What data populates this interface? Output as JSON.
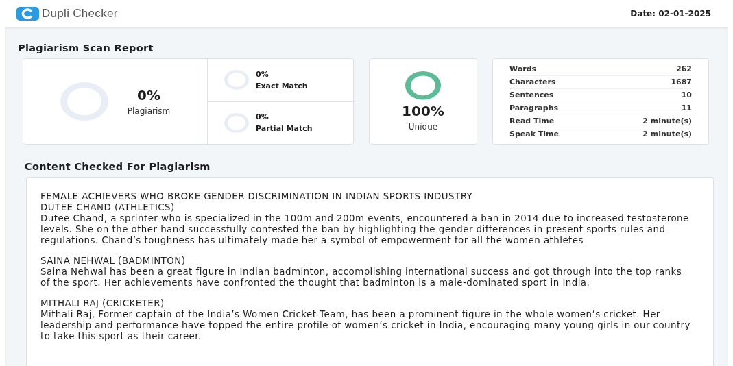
{
  "header": {
    "logo_text": "Dupli Checker",
    "date": "Date: 02-01-2025"
  },
  "report": {
    "title": "Plagiarism Scan Report",
    "plagiarism": {
      "value": "0%",
      "label": "Plagiarism"
    },
    "matches": [
      {
        "value": "0%",
        "label": "Exact Match"
      },
      {
        "value": "0%",
        "label": "Partial Match"
      }
    ],
    "unique": {
      "value": "100%",
      "label": "Unique"
    },
    "stats": [
      {
        "label": "Words",
        "value": "262"
      },
      {
        "label": "Characters",
        "value": "1687"
      },
      {
        "label": "Sentences",
        "value": "10"
      },
      {
        "label": "Paragraphs",
        "value": "11"
      },
      {
        "label": "Read Time",
        "value": "2 minute(s)"
      },
      {
        "label": "Speak Time",
        "value": "2 minute(s)"
      }
    ]
  },
  "content": {
    "title": "Content Checked For Plagiarism",
    "heading": "FEMALE ACHIEVERS WHO BROKE GENDER DISCRIMINATION IN INDIAN SPORTS INDUSTRY",
    "sections": [
      {
        "title": "DUTEE CHAND (ATHLETICS)",
        "body": "Dutee Chand, a sprinter who is specialized in the 100m and 200m events, encountered a ban in 2014 due to increased testosterone levels. She on the other hand successfully contested the ban by highlighting the gender differences in present sports rules and regulations. Chand’s toughness has ultimately made her a symbol of empowerment for all the women athletes"
      },
      {
        "title": "SAINA NEHWAL (BADMINTON)",
        "body": "Saina Nehwal has been a great figure in Indian badminton, accomplishing international success and got through into the top ranks of the sport. Her achievements have confronted the thought that badminton is a male-dominated sport in India."
      },
      {
        "title": "MITHALI RAJ (CRICKETER)",
        "body": "Mithali Raj, Former captain of the India’s Women Cricket Team, has been a prominent figure in the whole women’s cricket. Her leadership and performance have topped the entire profile of women’s cricket in India, encouraging many young girls in our country to take this sport as their career."
      }
    ]
  }
}
